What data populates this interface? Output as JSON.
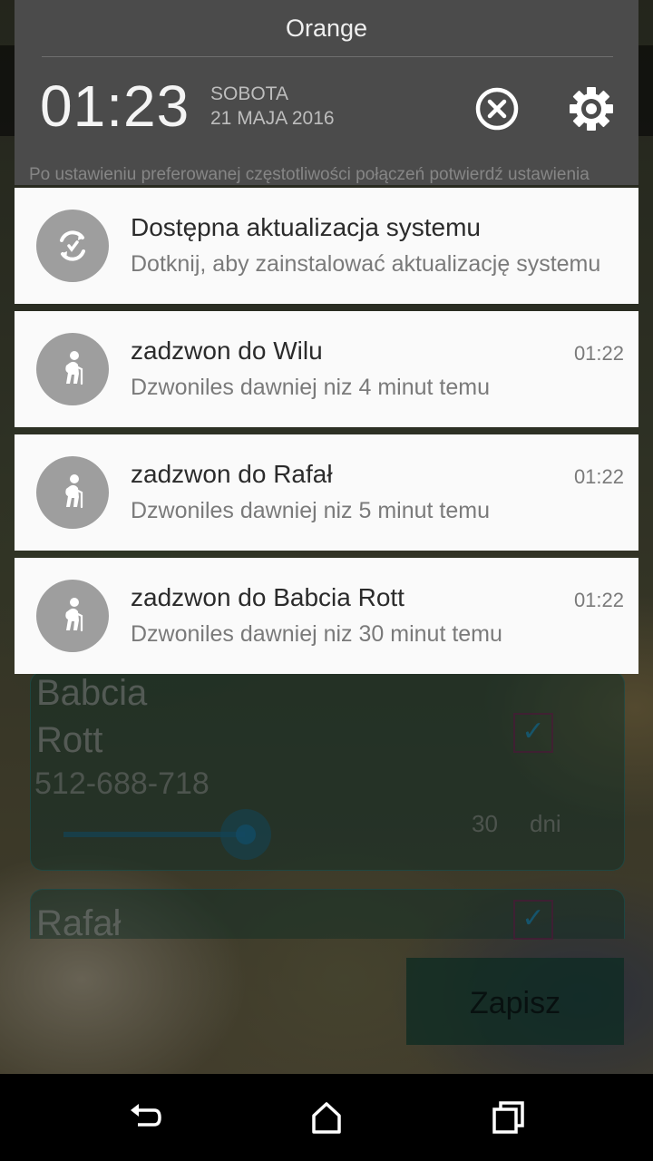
{
  "status": {
    "carrier": "Orange",
    "time": "01:23",
    "day": "SOBOTA",
    "date": "21 MAJA 2016"
  },
  "header_icons": {
    "dismiss": "close-circle-icon",
    "settings": "gear-icon"
  },
  "background_app": {
    "hint_text": "Po ustawieniu preferowanej częstotliwości połączeń potwierdź ustawienia",
    "contacts": [
      {
        "name_line1": "Babcia",
        "name_line2": "Rott",
        "phone": "512-688-718",
        "interval_value": "30",
        "interval_unit": "dni",
        "checked": true
      },
      {
        "name_line1": "Rafał",
        "checked": true
      }
    ],
    "save_label": "Zapisz"
  },
  "notifications": [
    {
      "title": "Dostępna aktualizacja systemu",
      "text": "Dotknij, aby zainstalować aktualizację systemu",
      "time": "",
      "icon": "system-update-icon"
    },
    {
      "title": "zadzwon do Wilu",
      "text": "Dzwoniles dawniej niz 4 minut temu",
      "time": "01:22",
      "icon": "elderly-person-icon"
    },
    {
      "title": "zadzwon do Rafał",
      "text": "Dzwoniles dawniej niz 5 minut temu",
      "time": "01:22",
      "icon": "elderly-person-icon"
    },
    {
      "title": "zadzwon do Babcia Rott",
      "text": "Dzwoniles dawniej niz 30 minut temu",
      "time": "01:22",
      "icon": "elderly-person-icon"
    }
  ],
  "navigation": {
    "back": "back-icon",
    "home": "home-icon",
    "recents": "recents-icon"
  }
}
